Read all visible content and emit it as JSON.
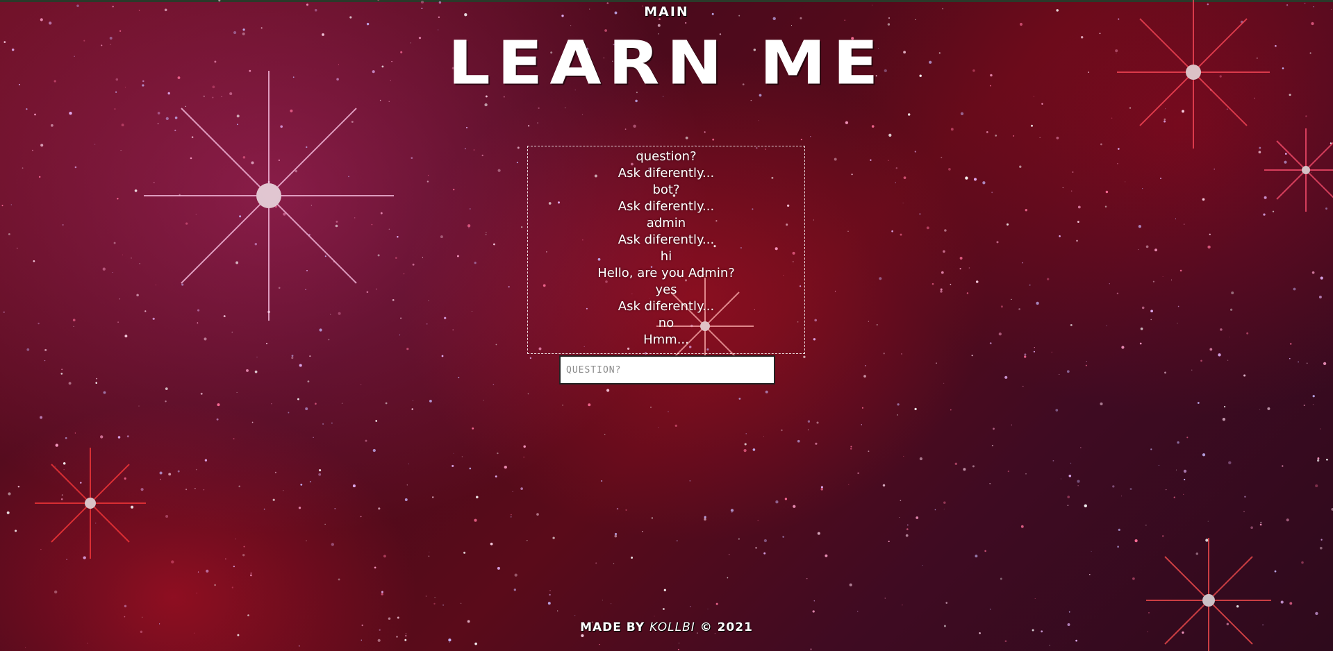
{
  "nav": {
    "main_label": "MAIN"
  },
  "header": {
    "title": "LEARN ME"
  },
  "chat": {
    "messages": [
      "question?",
      "Ask diferently...",
      "bot?",
      "Ask diferently...",
      "admin",
      "Ask diferently...",
      "hi",
      "Hello, are you Admin?",
      "yes",
      "Ask diferently...",
      "no",
      "Hmm..."
    ],
    "input": {
      "placeholder": "QUESTION?",
      "value": ""
    }
  },
  "footer": {
    "made_by_label": "MADE BY",
    "author": "KOLLBI",
    "copyright": "© 2021"
  },
  "colors": {
    "background_primary": "#5a0b1a",
    "text": "#ffffff",
    "input_background": "#ffffff"
  }
}
